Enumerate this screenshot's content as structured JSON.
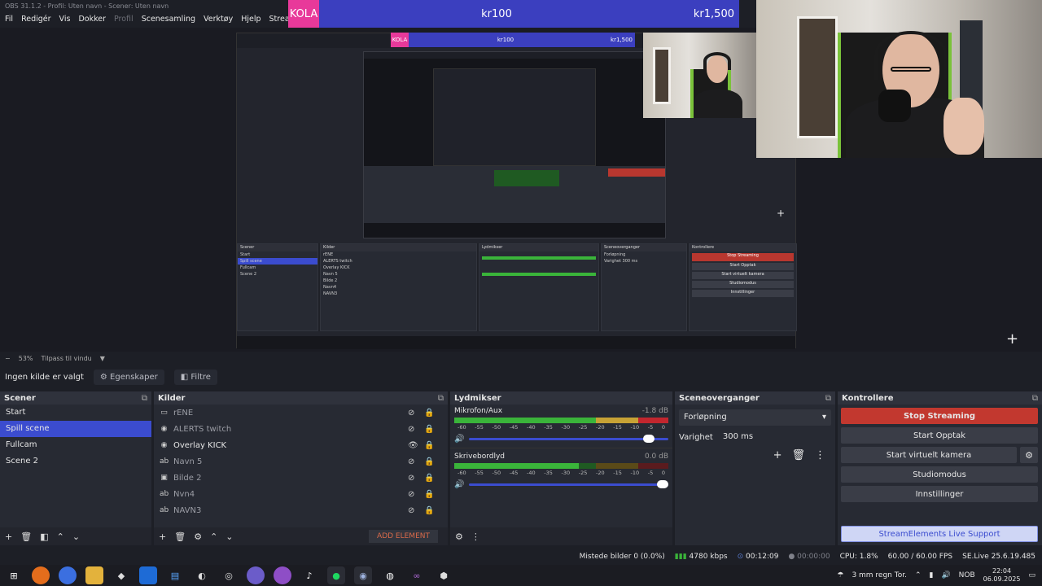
{
  "window": {
    "title": "OBS 31.1.2 - Profil: Uten navn - Scener: Uten navn"
  },
  "menu": [
    "Fil",
    "Redigér",
    "Vis",
    "Dokker",
    "Profil",
    "Scenesamling",
    "Verktøy",
    "Hjelp",
    "StreamElement"
  ],
  "banner": {
    "tag": "KOLA",
    "middle": "kr100",
    "right": "kr1,500"
  },
  "zoom": {
    "collapse": "−",
    "level": "53%",
    "fit_label": "Tilpass til vindu",
    "dropdown_icon": "▼"
  },
  "source_toolbar": {
    "no_source": "Ingen kilde er valgt",
    "properties": "Egenskaper",
    "filters": "Filtre"
  },
  "scenes": {
    "title": "Scener",
    "items": [
      "Start",
      "Spill scene",
      "Fullcam",
      "Scene 2"
    ],
    "selected": "Spill scene"
  },
  "sources": {
    "title": "Kilder",
    "items": [
      {
        "icon": "display-icon",
        "glyph": "▭",
        "label": "rENE",
        "visible": false
      },
      {
        "icon": "browser-icon",
        "glyph": "◉",
        "label": "ALERTS twitch",
        "visible": false
      },
      {
        "icon": "browser-icon",
        "glyph": "◉",
        "label": "Overlay KICK",
        "visible": true
      },
      {
        "icon": "text-icon",
        "glyph": "ab",
        "label": "Navn 5",
        "visible": false
      },
      {
        "icon": "image-icon",
        "glyph": "▣",
        "label": "Bilde 2",
        "visible": false
      },
      {
        "icon": "text-icon",
        "glyph": "ab",
        "label": "Nvn4",
        "visible": false
      },
      {
        "icon": "text-icon",
        "glyph": "ab",
        "label": "NAVN3",
        "visible": false
      }
    ],
    "add_element": "ADD ELEMENT"
  },
  "mixer": {
    "title": "Lydmikser",
    "channels": [
      {
        "name": "Mikrofon/Aux",
        "db": "-1.8 dB",
        "volume": 0.93
      },
      {
        "name": "Skrivebordlyd",
        "db": "0.0 dB",
        "volume": 1.0
      }
    ],
    "scale": [
      "-60",
      "-55",
      "-50",
      "-45",
      "-40",
      "-35",
      "-30",
      "-25",
      "-20",
      "-15",
      "-10",
      "-5",
      "0"
    ]
  },
  "transitions": {
    "title": "Sceneoverganger",
    "selected": "Forløpning",
    "duration_label": "Varighet",
    "duration": "300 ms"
  },
  "controls": {
    "title": "Kontrollere",
    "stop_streaming": "Stop Streaming",
    "start_recording": "Start Opptak",
    "virtual_camera": "Start virtuelt kamera",
    "studio_mode": "Studiomodus",
    "settings": "Innstillinger",
    "se_support": "StreamElements Live Support"
  },
  "status": {
    "dropped": "Mistede bilder 0 (0.0%)",
    "bitrate": "4780 kbps",
    "stream_time": "00:12:09",
    "rec_time": "00:00:00",
    "cpu": "CPU: 1.8%",
    "fps": "60.00 / 60.00 FPS",
    "version": "SE.Live 25.6.19.485"
  },
  "taskbar": {
    "weather": "3 mm regn Tor.",
    "lang": "NOB",
    "time": "22:04",
    "date": "06.09.2025"
  },
  "colors": {
    "accent": "#3b4ccf",
    "stop": "#c2382f",
    "kola": "#e8399a",
    "banner": "#3b3fbf"
  }
}
